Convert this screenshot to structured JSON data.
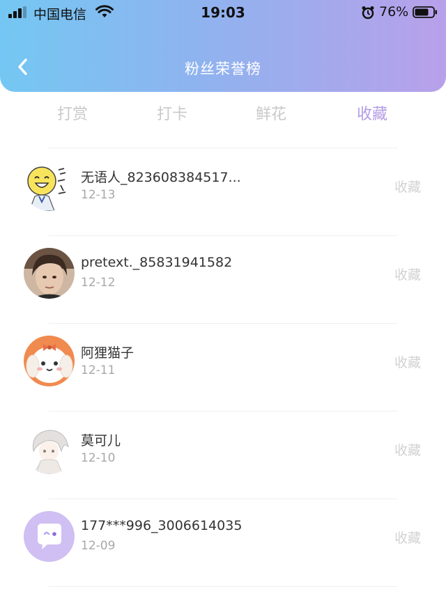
{
  "status_bar": {
    "carrier": "中国电信",
    "time": "19:03",
    "battery": "76%"
  },
  "header": {
    "title": "粉丝荣誉榜",
    "back_icon": "chevron-left-icon"
  },
  "tabs": [
    {
      "label": "打赏",
      "active": false
    },
    {
      "label": "打卡",
      "active": false
    },
    {
      "label": "鲜花",
      "active": false
    },
    {
      "label": "收藏",
      "active": true
    }
  ],
  "list": [
    {
      "name": "无语人_823608384517...",
      "date": "12-13",
      "action": "收藏",
      "avatar": "emoji-face-avatar"
    },
    {
      "name": "pretext._85831941582",
      "date": "12-12",
      "action": "收藏",
      "avatar": "portrait-photo-avatar"
    },
    {
      "name": "阿狸猫子",
      "date": "12-11",
      "action": "收藏",
      "avatar": "cartoon-dog-avatar"
    },
    {
      "name": "莫可儿",
      "date": "12-10",
      "action": "收藏",
      "avatar": "anime-girl-avatar"
    },
    {
      "name": "177***996_3006614035",
      "date": "12-09",
      "action": "收藏",
      "avatar": "chat-bubble-avatar"
    }
  ],
  "colors": {
    "header_gradient_start": "#74c7f2",
    "header_gradient_end": "#b8a0ea",
    "active_tab": "#b39be6",
    "inactive_tab": "#c9c9c9"
  }
}
